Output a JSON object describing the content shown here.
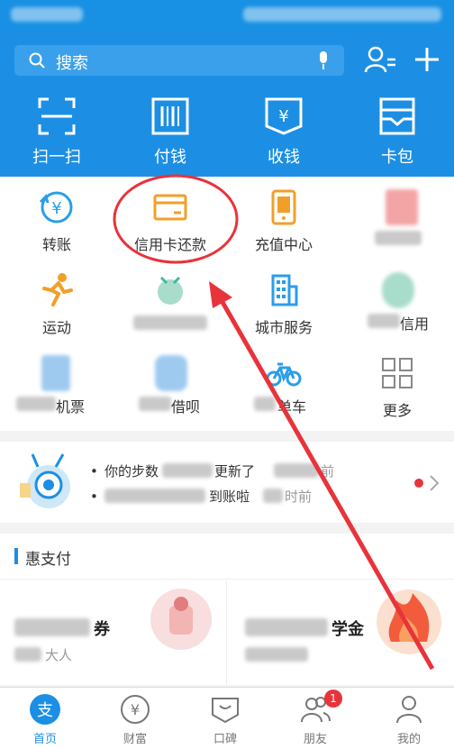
{
  "header": {
    "search_placeholder": "搜索",
    "actions": [
      {
        "label": "扫一扫",
        "icon": "scan-icon"
      },
      {
        "label": "付钱",
        "icon": "pay-barcode-icon"
      },
      {
        "label": "收钱",
        "icon": "receive-money-icon"
      },
      {
        "label": "卡包",
        "icon": "card-wallet-icon"
      }
    ]
  },
  "grid": {
    "items": [
      {
        "label": "转账",
        "icon": "transfer-icon",
        "color": "#2a9ee8"
      },
      {
        "label": "信用卡还款",
        "icon": "credit-card-icon",
        "color": "#f0a028"
      },
      {
        "label": "充值中心",
        "icon": "phone-topup-icon",
        "color": "#f0a028"
      },
      {
        "label": "",
        "icon": "blurred-app-icon",
        "color": "#e86a6a"
      },
      {
        "label": "运动",
        "icon": "running-icon",
        "color": "#f0a028"
      },
      {
        "label": "",
        "icon": "blurred-app-icon",
        "color": "#3fb8a0"
      },
      {
        "label": "城市服务",
        "icon": "city-building-icon",
        "color": "#2a9ee8"
      },
      {
        "label": "信用",
        "icon": "blurred-app-icon",
        "color": "#3fb8a0"
      },
      {
        "label": "机票",
        "icon": "blurred-app-icon",
        "color": "#2a9ee8"
      },
      {
        "label": "借呗",
        "icon": "blurred-app-icon",
        "color": "#2a9ee8"
      },
      {
        "label": "单车",
        "icon": "bicycle-icon",
        "color": "#2a9ee8"
      },
      {
        "label": "更多",
        "icon": "more-grid-icon",
        "color": "#888888"
      }
    ]
  },
  "notice": {
    "line1_a": "你的步数",
    "line1_b": "更新了",
    "line1_time": "前",
    "line2_a": "",
    "line2_b": "到账啦",
    "line2_time": "时前"
  },
  "hui": {
    "title": "惠支付",
    "card1_title": "券",
    "card1_sub": "大人",
    "card2_title": "学金"
  },
  "tabbar": {
    "tabs": [
      {
        "label": "首页",
        "icon": "home-alipay-icon"
      },
      {
        "label": "财富",
        "icon": "wealth-yen-icon"
      },
      {
        "label": "口碑",
        "icon": "koubei-icon"
      },
      {
        "label": "朋友",
        "icon": "friends-icon",
        "badge": "1"
      },
      {
        "label": "我的",
        "icon": "profile-icon"
      }
    ]
  },
  "colors": {
    "header_blue": "#1c8fe4",
    "annotation_red": "#e8333a"
  }
}
